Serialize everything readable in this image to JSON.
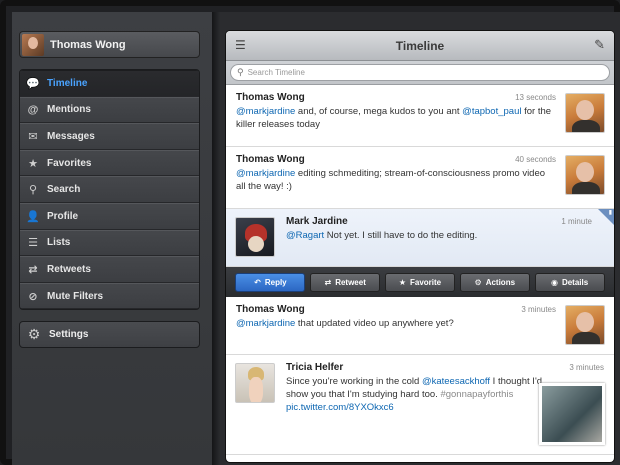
{
  "account": {
    "name": "Thomas Wong"
  },
  "sidebar": {
    "items": [
      {
        "label": "Timeline",
        "icon": "bubble-icon",
        "glyph": "💬"
      },
      {
        "label": "Mentions",
        "icon": "at-icon",
        "glyph": "@"
      },
      {
        "label": "Messages",
        "icon": "envelope-icon",
        "glyph": "✉"
      },
      {
        "label": "Favorites",
        "icon": "star-icon",
        "glyph": "★"
      },
      {
        "label": "Search",
        "icon": "search-icon",
        "glyph": "⚲"
      },
      {
        "label": "Profile",
        "icon": "person-icon",
        "glyph": "👤"
      },
      {
        "label": "Lists",
        "icon": "list-icon",
        "glyph": "☰"
      },
      {
        "label": "Retweets",
        "icon": "retweet-icon",
        "glyph": "⇄"
      },
      {
        "label": "Mute Filters",
        "icon": "mute-icon",
        "glyph": "⊘"
      }
    ],
    "active_index": 0,
    "settings_label": "Settings",
    "accent_color": "#4aa3ff"
  },
  "header": {
    "title": "Timeline"
  },
  "search": {
    "placeholder": "Search Timeline"
  },
  "tweets": [
    {
      "author": "Thomas Wong",
      "time": "13 seconds",
      "parts": [
        {
          "t": "@markjardine",
          "k": "mention"
        },
        {
          "t": " and, of course, mega kudos to you ant ",
          "k": "text"
        },
        {
          "t": "@tapbot_paul",
          "k": "mention"
        },
        {
          "t": " for the killer releases today",
          "k": "text"
        }
      ]
    },
    {
      "author": "Thomas Wong",
      "time": "40 seconds",
      "parts": [
        {
          "t": "@markjardine",
          "k": "mention"
        },
        {
          "t": " editing schmediting; stream-of-consciousness promo video all the way! :)",
          "k": "text"
        }
      ]
    },
    {
      "author": "Mark Jardine",
      "time": "1 minute",
      "parts": [
        {
          "t": "@Ragart",
          "k": "mention"
        },
        {
          "t": " Not yet. I still have to do the editing.",
          "k": "text"
        }
      ]
    },
    {
      "author": "Thomas Wong",
      "time": "3 minutes",
      "parts": [
        {
          "t": "@markjardine",
          "k": "mention"
        },
        {
          "t": " that updated video up anywhere yet?",
          "k": "text"
        }
      ]
    },
    {
      "author": "Tricia Helfer",
      "time": "3 minutes",
      "parts": [
        {
          "t": "Since you're working in the cold ",
          "k": "text"
        },
        {
          "t": "@kateesackhoff",
          "k": "mention"
        },
        {
          "t": " I thought I'd show you that I'm studying hard too. ",
          "k": "text"
        },
        {
          "t": "#gonnapayforthis",
          "k": "tag"
        },
        {
          "t": " ",
          "k": "text"
        },
        {
          "t": "pic.twitter.com/8YXOkxc6",
          "k": "link"
        }
      ]
    }
  ],
  "actions": {
    "reply": "Reply",
    "retweet": "Retweet",
    "favorite": "Favorite",
    "actions": "Actions",
    "details": "Details"
  }
}
